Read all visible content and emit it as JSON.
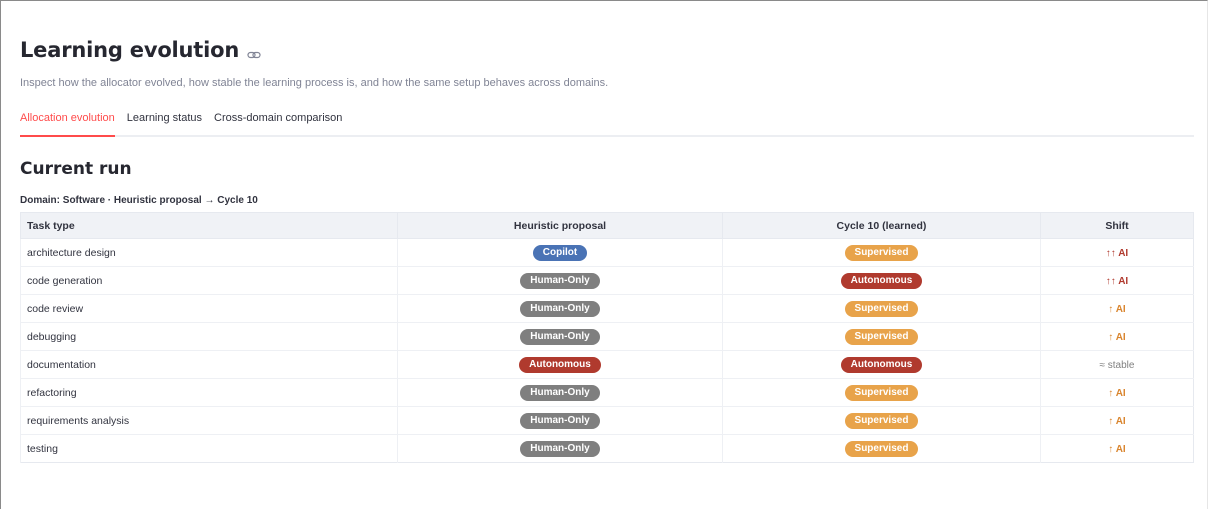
{
  "page": {
    "title": "Learning evolution",
    "subtitle": "Inspect how the allocator evolved, how stable the learning process is, and how the same setup behaves across domains."
  },
  "tabs": [
    {
      "label": "Allocation evolution",
      "active": true
    },
    {
      "label": "Learning status",
      "active": false
    },
    {
      "label": "Cross-domain comparison",
      "active": false
    }
  ],
  "section": {
    "title": "Current run",
    "domain_line": "Domain: Software · Heuristic proposal → Cycle 10"
  },
  "table": {
    "columns": [
      "Task type",
      "Heuristic proposal",
      "Cycle 10 (learned)",
      "Shift"
    ],
    "rows": [
      {
        "task": "architecture design",
        "heuristic": "Copilot",
        "learned": "Supervised",
        "shift": "↑↑ AI",
        "shift_kind": "strong"
      },
      {
        "task": "code generation",
        "heuristic": "Human-Only",
        "learned": "Autonomous",
        "shift": "↑↑ AI",
        "shift_kind": "strong"
      },
      {
        "task": "code review",
        "heuristic": "Human-Only",
        "learned": "Supervised",
        "shift": "↑ AI",
        "shift_kind": "mild"
      },
      {
        "task": "debugging",
        "heuristic": "Human-Only",
        "learned": "Supervised",
        "shift": "↑ AI",
        "shift_kind": "mild"
      },
      {
        "task": "documentation",
        "heuristic": "Autonomous",
        "learned": "Autonomous",
        "shift": "≈ stable",
        "shift_kind": "stable"
      },
      {
        "task": "refactoring",
        "heuristic": "Human-Only",
        "learned": "Supervised",
        "shift": "↑ AI",
        "shift_kind": "mild"
      },
      {
        "task": "requirements analysis",
        "heuristic": "Human-Only",
        "learned": "Supervised",
        "shift": "↑ AI",
        "shift_kind": "mild"
      },
      {
        "task": "testing",
        "heuristic": "Human-Only",
        "learned": "Supervised",
        "shift": "↑ AI",
        "shift_kind": "mild"
      }
    ]
  },
  "colors": {
    "Copilot": "#4a73b5",
    "Human-Only": "#7f7f7f",
    "Supervised": "#e8a34a",
    "Autonomous": "#b03a2e",
    "shift_strong": "#b03a2e",
    "shift_mild": "#d9852e",
    "shift_stable": "#808080",
    "accent": "#ff4b4b"
  }
}
